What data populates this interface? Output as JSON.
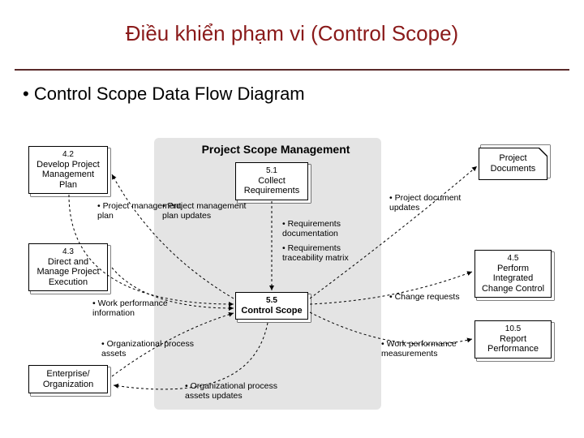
{
  "title": "Điều khiển phạm vi (Control Scope)",
  "subhead": "Control Scope Data Flow Diagram",
  "psm_title": "Project Scope Management",
  "boxes": {
    "b42": {
      "num": "4.2",
      "txt": "Develop Project Management Plan"
    },
    "b43": {
      "num": "4.3",
      "txt": "Direct and Manage Project Execution"
    },
    "bent": {
      "num": "",
      "txt": "Enterprise/ Organization"
    },
    "b51": {
      "num": "5.1",
      "txt": "Collect Requirements"
    },
    "b55": {
      "num": "5.5",
      "txt": "Control Scope"
    },
    "bdoc": {
      "num": "",
      "txt": "Project Documents"
    },
    "b45": {
      "num": "4.5",
      "txt": "Perform Integrated Change Control"
    },
    "b105": {
      "num": "10.5",
      "txt": "Report Performance"
    }
  },
  "bullets": {
    "pmplan": "Project management plan",
    "wpi": "Work performance information",
    "opa": "Organizational process assets",
    "pmpu": "Project management plan updates",
    "reqdoc": "Requirements documentation",
    "reqtrace": "Requirements traceability matrix",
    "opau": "Organizational process assets updates",
    "pdu": "Project document updates",
    "cr": "Change requests",
    "wpm": "Work performance measurements"
  },
  "chart_data": {
    "type": "flow-diagram",
    "nodes": [
      {
        "id": "4.2",
        "label": "Develop Project Management Plan"
      },
      {
        "id": "4.3",
        "label": "Direct and Manage Project Execution"
      },
      {
        "id": "ENT",
        "label": "Enterprise/Organization"
      },
      {
        "id": "5.1",
        "label": "Collect Requirements"
      },
      {
        "id": "5.5",
        "label": "Control Scope",
        "focus": true
      },
      {
        "id": "DOC",
        "label": "Project Documents"
      },
      {
        "id": "4.5",
        "label": "Perform Integrated Change Control"
      },
      {
        "id": "10.5",
        "label": "Report Performance"
      }
    ],
    "edges": [
      {
        "from": "4.2",
        "to": "5.5",
        "label": "Project management plan"
      },
      {
        "from": "4.3",
        "to": "5.5",
        "label": "Work performance information"
      },
      {
        "from": "ENT",
        "to": "5.5",
        "label": "Organizational process assets"
      },
      {
        "from": "5.1",
        "to": "5.5",
        "label": "Requirements documentation; Requirements traceability matrix"
      },
      {
        "from": "5.5",
        "to": "4.2",
        "label": "Project management plan updates"
      },
      {
        "from": "5.5",
        "to": "ENT",
        "label": "Organizational process assets updates"
      },
      {
        "from": "5.5",
        "to": "DOC",
        "label": "Project document updates"
      },
      {
        "from": "5.5",
        "to": "4.5",
        "label": "Change requests"
      },
      {
        "from": "5.5",
        "to": "10.5",
        "label": "Work performance measurements"
      }
    ]
  }
}
